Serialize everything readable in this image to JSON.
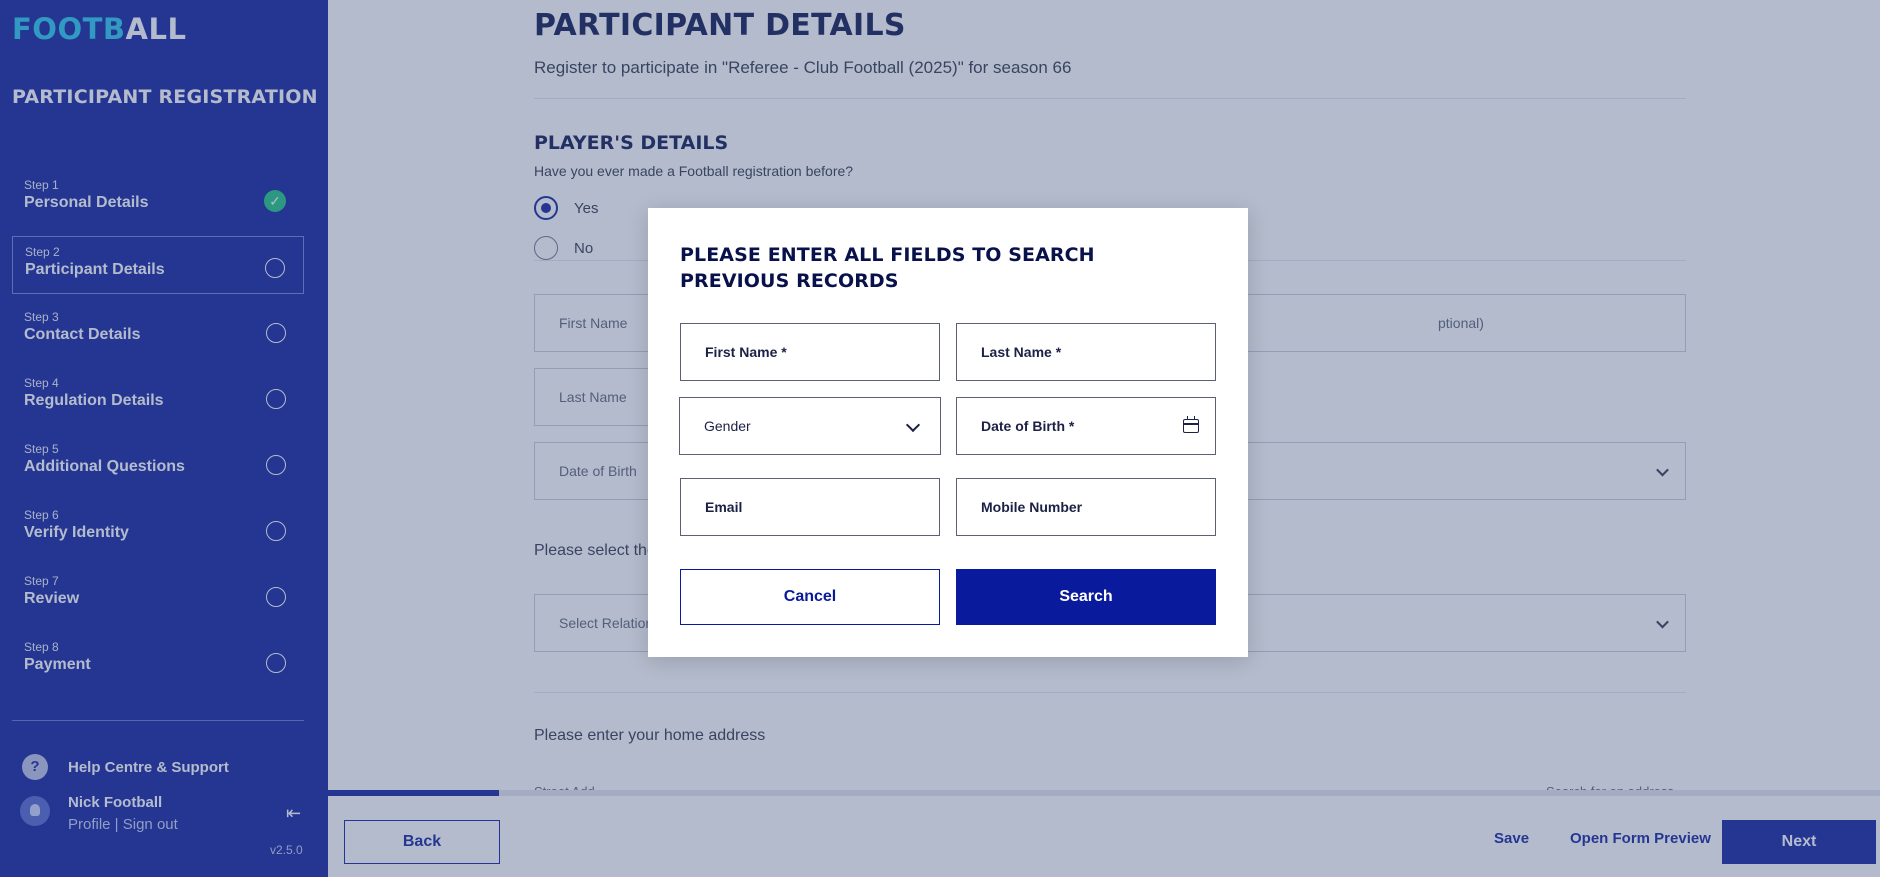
{
  "sidebar": {
    "logo_part1": "FOOTB",
    "logo_part2": "ALL",
    "title": "PARTICIPANT REGISTRATION",
    "steps": [
      {
        "step": "Step 1",
        "label": "Personal Details",
        "status": "complete"
      },
      {
        "step": "Step 2",
        "label": "Participant Details",
        "status": "current"
      },
      {
        "step": "Step 3",
        "label": "Contact Details",
        "status": "pending"
      },
      {
        "step": "Step 4",
        "label": "Regulation Details",
        "status": "pending"
      },
      {
        "step": "Step 5",
        "label": "Additional Questions",
        "status": "pending"
      },
      {
        "step": "Step 6",
        "label": "Verify Identity",
        "status": "pending"
      },
      {
        "step": "Step 7",
        "label": "Review",
        "status": "pending"
      },
      {
        "step": "Step 8",
        "label": "Payment",
        "status": "pending"
      }
    ],
    "help_label": "Help Centre & Support",
    "help_icon": "?",
    "user_name": "Nick Football",
    "user_links": "Profile | Sign out",
    "version": "v2.5.0"
  },
  "main": {
    "title": "PARTICIPANT DETAILS",
    "subtitle": "Register to participate in \"Referee - Club Football (2025)\" for season 66",
    "section_title": "PLAYER'S DETAILS",
    "question": "Have you ever made a Football registration before?",
    "options": [
      "Yes",
      "No"
    ],
    "selected_option": "Yes",
    "fields": {
      "first_name": "First Name",
      "middle_name_peek": "ptional)",
      "last_name": "Last Name",
      "dob": "Date of Birth"
    },
    "relationship_prompt": "Please select the",
    "relationship_placeholder": "Select Relations",
    "home_address_label": "Please enter your home address",
    "street_address_peek": "Street Add",
    "search_address_peek": "Search for an address"
  },
  "footer": {
    "back": "Back",
    "save": "Save",
    "preview": "Open Form Preview",
    "next": "Next",
    "progress_fraction": 0.11
  },
  "modal": {
    "title": "PLEASE ENTER ALL FIELDS TO SEARCH PREVIOUS RECORDS",
    "first_name": "First Name *",
    "last_name": "Last Name *",
    "gender": "Gender",
    "dob": "Date of Birth *",
    "email": "Email",
    "mobile": "Mobile Number",
    "cancel": "Cancel",
    "search": "Search"
  },
  "colors": {
    "brand_primary": "#0a1a9c",
    "brand_accent": "#20c4ee",
    "success": "#17c37b"
  }
}
